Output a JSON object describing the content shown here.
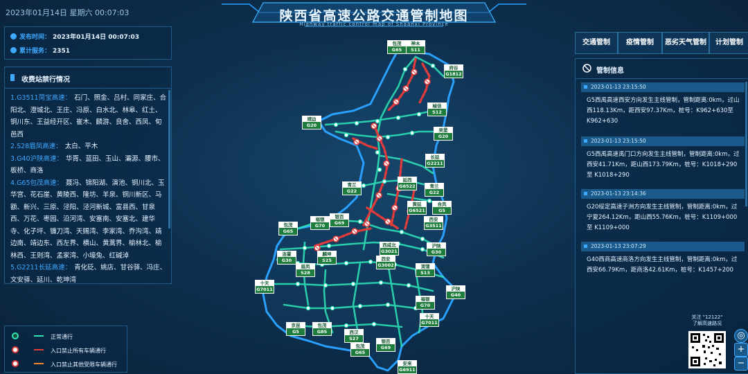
{
  "header": {
    "datetime": "2023年01月14日 星期六 00:07:03",
    "title": "陕西省高速公路交通管制地图",
    "subtitle": "Highway traffic control map of Shaanxi Province"
  },
  "info": {
    "publish_label": "发布时间：",
    "publish_value": "2023年01月14日 00:07:03",
    "service_label": "累计服务：",
    "service_value": "2351"
  },
  "toll": {
    "title": "收费站禁行情况",
    "items": [
      {
        "road": "1.G3511菏宝高速：",
        "text": "石门、照金、吕村、同家庄、合阳北、澄城北、王庄、冯原、白水北、林皋、红土、铜川东、王益经开区、崔木、麟游、良舍、西凤、旬邑西"
      },
      {
        "road": "2.S28眉凤高速：",
        "text": "太白、平木"
      },
      {
        "road": "3.G40沪陕高速：",
        "text": "华胥、蓝田、玉山、灞源、腰市、板桥、商洛"
      },
      {
        "road": "4.G65包茂高速：",
        "text": "聂冯、锦阳湖、演池、铜川北、玉华宫、花石崖、黄陵西、隆坊、羊泉、铜川新区、马额、新兴、三原、泾阳、泾河新城、富县西、甘泉西、万花、枣园、沿河湾、安塞南、安塞北、建华寺、化子坪、镰刀湾、天赐湾、李家湾、乔沟湾、靖边南、靖边东、西左界、横山、黄蒿界、榆林北、榆林西、王则湾、孟家湾、小壕兔、红碱淖"
      },
      {
        "road": "5.G2211长延高速：",
        "text": "青化砭、姚店、甘谷驿、冯庄、文安驿、延川、乾坤湾"
      }
    ]
  },
  "legend": {
    "items": [
      {
        "label": "正常通行",
        "color": "#2ee6b8"
      },
      {
        "label": "入口禁止所有车辆通行",
        "color": "#e23b3b"
      },
      {
        "label": "入口禁止其他受限车辆通行",
        "color": "#f08a24"
      }
    ]
  },
  "tabs": [
    "交通管制",
    "疫情管制",
    "恶劣天气管制",
    "计划管制"
  ],
  "control": {
    "title": "管制信息",
    "items": [
      {
        "time": "2023-01-13 23:15:50",
        "text": "G5西禹高速西安方向发生主线管制，管制距离:0km，过山西118.13Km，距西安97.37Km，桩号：K962+630至 K962+630"
      },
      {
        "time": "2023-01-13 23:15:50",
        "text": "G5西禹高速禹门口方向发生主线管制，管制距离:0km，过西安41.71Km，距山西173.79Km，桩号：K1018+290 至 K1018+290"
      },
      {
        "time": "2023-01-13 23:14:36",
        "text": "G20绥定高速子洲方向发生主线管制，管制距离:0km，过宁夏264.12Km，距山西55.76Km，桩号：K1109+000 至 K1109+000"
      },
      {
        "time": "2023-01-13 23:07:29",
        "text": "G40西商高速商洛方向发生主线管制，管制距离:0km，过西安66.79Km，距商洛42.61Km，桩号：K1457+200"
      }
    ]
  },
  "qr": {
    "text1": "关注 \"12122\"",
    "text2": "了解高速路况"
  },
  "zoom": {
    "plus": "+",
    "minus": "−"
  },
  "map": {
    "signs": [
      {
        "a": "神木",
        "b": "S11"
      },
      {
        "a": "府谷",
        "b": "G1812"
      },
      {
        "a": "榆佳",
        "b": "S12"
      },
      {
        "a": "吴堡",
        "b": "G20"
      },
      {
        "a": "靖边",
        "b": "G20"
      },
      {
        "a": "长延",
        "b": "G2211"
      },
      {
        "a": "延西",
        "b": "G6522"
      },
      {
        "a": "青兰",
        "b": "G22"
      },
      {
        "a": "黄延",
        "b": "G6521"
      },
      {
        "a": "合凤",
        "b": "G5"
      },
      {
        "a": "西安",
        "b": "G3511"
      },
      {
        "a": "青兰",
        "b": "G22"
      },
      {
        "a": "福银",
        "b": "G70"
      },
      {
        "a": "银百",
        "b": "G69"
      },
      {
        "a": "包茂",
        "b": "G65"
      },
      {
        "a": "西咸北",
        "b": "G3021"
      },
      {
        "a": "西安",
        "b": "G3002"
      },
      {
        "a": "麟坤",
        "b": "S25"
      },
      {
        "a": "沪陕",
        "b": "G30"
      },
      {
        "a": "连霍",
        "b": "G30"
      },
      {
        "a": "眉凤",
        "b": "S28"
      },
      {
        "a": "渭蒲",
        "b": "S13"
      },
      {
        "a": "十天",
        "b": "G7011"
      },
      {
        "a": "沪陕",
        "b": "G40"
      },
      {
        "a": "福银",
        "b": "G70"
      },
      {
        "a": "十天",
        "b": "G7011"
      },
      {
        "a": "京昆",
        "b": "G5"
      },
      {
        "a": "包茂",
        "b": "G85"
      },
      {
        "a": "西汉",
        "b": "S27"
      },
      {
        "a": "包茂",
        "b": "G65"
      },
      {
        "a": "银百",
        "b": "G69"
      },
      {
        "a": "安来",
        "b": "G6911"
      },
      {
        "a": "包茂",
        "b": "G65"
      }
    ]
  }
}
